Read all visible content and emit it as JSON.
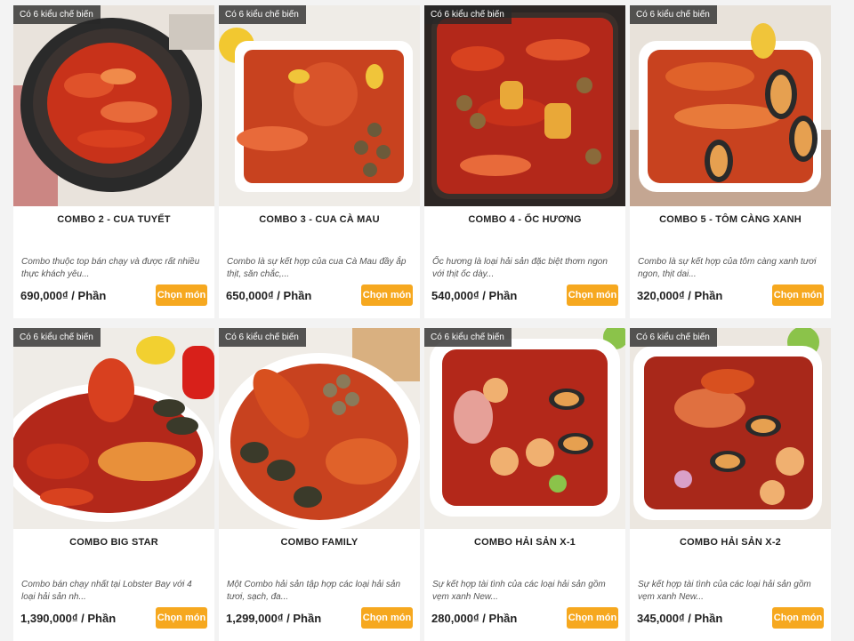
{
  "products": [
    {
      "badge": "Có 6 kiểu chế biến",
      "title": "COMBO 2 - CUA TUYẾT",
      "desc": "Combo thuộc top bán chạy và được rất nhiều thực khách yêu...",
      "price": "690,000₫",
      "unit": "Phần",
      "button": "Chọn món"
    },
    {
      "badge": "Có 6 kiểu chế biến",
      "title": "COMBO 3 - CUA CÀ MAU",
      "desc": "Combo là sự kết hợp của cua Cà Mau đầy ắp thịt, săn chắc,...",
      "price": "650,000₫",
      "unit": "Phần",
      "button": "Chọn món"
    },
    {
      "badge": "Có 6 kiểu chế biến",
      "title": "COMBO 4 - ỐC HƯƠNG",
      "desc": "Ốc hương là loại hải sản đặc biệt thơm ngon với thịt ốc dày...",
      "price": "540,000₫",
      "unit": "Phần",
      "button": "Chọn món"
    },
    {
      "badge": "Có 6 kiểu chế biến",
      "title": "COMBO 5 - TÔM CÀNG XANH",
      "desc": "Combo là sự kết hợp của tôm càng xanh tươi ngon, thịt dai...",
      "price": "320,000₫",
      "unit": "Phần",
      "button": "Chọn món"
    },
    {
      "badge": "Có 6 kiểu chế biến",
      "title": "COMBO BIG STAR",
      "desc": "Combo bán chạy nhất tại Lobster Bay với 4 loại hải sản nh...",
      "price": "1,390,000₫",
      "unit": "Phần",
      "button": "Chọn món"
    },
    {
      "badge": "Có 6 kiểu chế biến",
      "title": "COMBO FAMILY",
      "desc": "Một Combo hải sản tập hợp các loại hải sản tươi, sạch, đa...",
      "price": "1,299,000₫",
      "unit": "Phần",
      "button": "Chọn món"
    },
    {
      "badge": "Có 6 kiểu chế biến",
      "title": "COMBO HẢI SẢN X-1",
      "desc": "Sự kết hợp tài tình của các loại hải sản gồm vẹm xanh New...",
      "price": "280,000₫",
      "unit": "Phần",
      "button": "Chọn món"
    },
    {
      "badge": "Có 6 kiểu chế biến",
      "title": "COMBO HẢI SẢN X-2",
      "desc": "Sự kết hợp tài tình của các loại hải sản gồm vẹm xanh New...",
      "price": "345,000₫",
      "unit": "Phần",
      "button": "Chọn món"
    }
  ],
  "colors": {
    "button_bg": "#f6a81f",
    "badge_bg": "#282828",
    "sauce": "#c8321a",
    "card_bg": "#ffffff",
    "page_bg": "#f3f3f3"
  },
  "price_separator": "/"
}
